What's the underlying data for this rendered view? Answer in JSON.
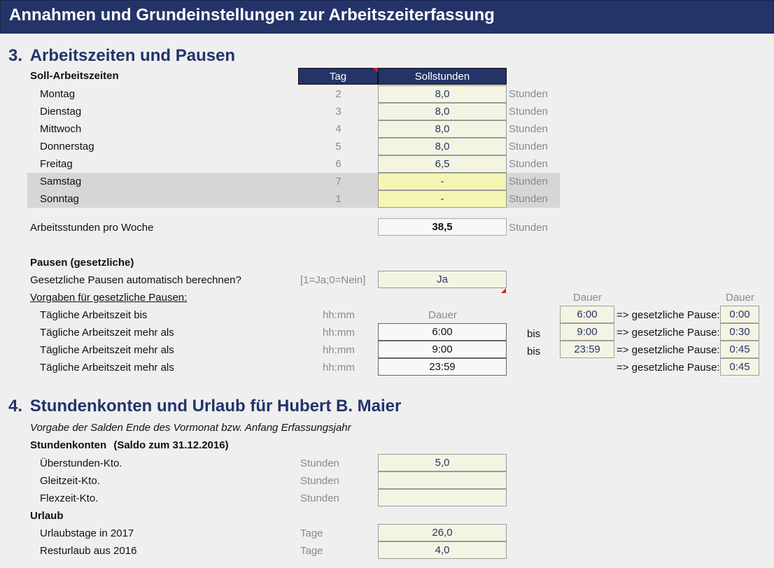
{
  "title": "Annahmen und Grundeinstellungen zur Arbeitszeiterfassung",
  "section3": {
    "number": "3.",
    "title": "Arbeitszeiten und Pausen",
    "soll_label": "Soll-Arbeitszeiten",
    "col_tag": "Tag",
    "col_soll": "Sollstunden",
    "unit": "Stunden",
    "days": [
      {
        "name": "Montag",
        "tag": "2",
        "soll": "8,0"
      },
      {
        "name": "Dienstag",
        "tag": "3",
        "soll": "8,0"
      },
      {
        "name": "Mittwoch",
        "tag": "4",
        "soll": "8,0"
      },
      {
        "name": "Donnerstag",
        "tag": "5",
        "soll": "8,0"
      },
      {
        "name": "Freitag",
        "tag": "6",
        "soll": "6,5"
      },
      {
        "name": "Samstag",
        "tag": "7",
        "soll": "-"
      },
      {
        "name": "Sonntag",
        "tag": "1",
        "soll": "-"
      }
    ],
    "week_label": "Arbeitsstunden pro Woche",
    "week_value": "38,5",
    "pausen_title": "Pausen (gesetzliche)",
    "auto_label": "Gesetzliche Pausen automatisch berechnen?",
    "auto_hint": "[1=Ja;0=Nein]",
    "auto_value": "Ja",
    "vorgaben_label": "Vorgaben für gesetzliche Pausen:",
    "dauer": "Dauer",
    "hhmm": "hh:mm",
    "bis": "bis",
    "pause_label": "=> gesetzliche Pause:",
    "rows": [
      {
        "label": "Tägliche Arbeitszeit bis",
        "from": "",
        "to": "6:00",
        "pause": "0:00"
      },
      {
        "label": "Tägliche Arbeitszeit mehr als",
        "from": "6:00",
        "to": "9:00",
        "pause": "0:30"
      },
      {
        "label": "Tägliche Arbeitszeit mehr als",
        "from": "9:00",
        "to": "23:59",
        "pause": "0:45"
      },
      {
        "label": "Tägliche Arbeitszeit mehr als",
        "from": "23:59",
        "to": "",
        "pause": "0:45"
      }
    ]
  },
  "section4": {
    "number": "4.",
    "title": "Stundenkonten und Urlaub für Hubert B. Maier",
    "subtitle": "Vorgabe der Salden Ende des Vormonat bzw. Anfang Erfassungsjahr",
    "konten_title": "Stundenkonten",
    "konten_saldo": "(Saldo zum 31.12.2016)",
    "unit_stunden": "Stunden",
    "konten": [
      {
        "label": "Überstunden-Kto.",
        "value": "5,0"
      },
      {
        "label": "Gleitzeit-Kto.",
        "value": ""
      },
      {
        "label": "Flexzeit-Kto.",
        "value": ""
      }
    ],
    "urlaub_title": "Urlaub",
    "unit_tage": "Tage",
    "urlaub": [
      {
        "label": "Urlaubstage in 2017",
        "value": "26,0"
      },
      {
        "label": "Resturlaub aus 2016",
        "value": "4,0"
      }
    ]
  }
}
